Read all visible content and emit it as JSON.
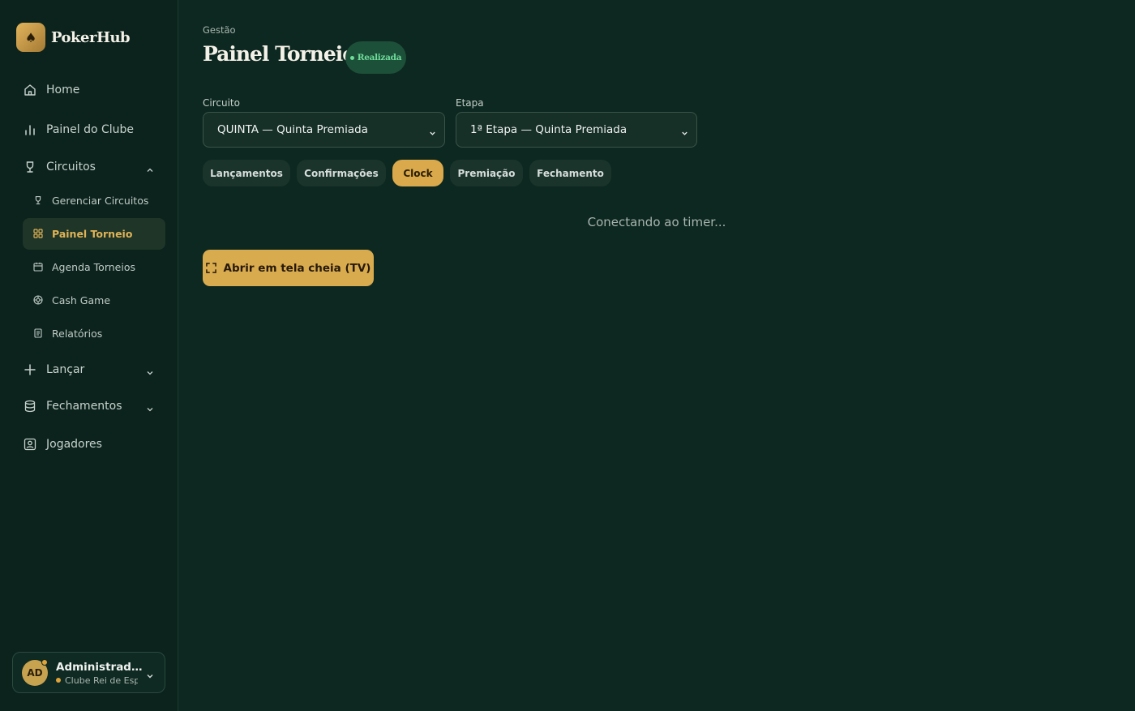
{
  "brand": {
    "name": "PokerHub",
    "logo_glyph": "♠"
  },
  "sidebar": {
    "items": [
      {
        "label": "Home",
        "icon": "home-icon"
      },
      {
        "label": "Painel do Clube",
        "icon": "bar-chart-icon"
      },
      {
        "label": "Circuitos",
        "icon": "trophy-icon",
        "expanded": true
      },
      {
        "label": "Lançar",
        "icon": "plus-icon",
        "expanded": false
      },
      {
        "label": "Fechamentos",
        "icon": "database-icon",
        "expanded": false
      },
      {
        "label": "Jogadores",
        "icon": "user-square-icon"
      }
    ],
    "circuit_subitems": [
      {
        "label": "Gerenciar Circuitos",
        "icon": "trophy-icon"
      },
      {
        "label": "Painel Torneio",
        "icon": "grid-icon",
        "active": true
      },
      {
        "label": "Agenda Torneios",
        "icon": "calendar-icon"
      },
      {
        "label": "Cash Game",
        "icon": "chip-icon"
      },
      {
        "label": "Relatórios",
        "icon": "report-icon"
      }
    ]
  },
  "user": {
    "initials": "AD",
    "name": "Administrador ...",
    "club": "Clube Rei de Espadas"
  },
  "header": {
    "breadcrumb": "Gestão",
    "title": "Painel Torneio",
    "status_badge": "Realizada"
  },
  "filters": {
    "circuit_label": "Circuito",
    "circuit_value": "QUINTA — Quinta Premiada",
    "stage_label": "Etapa",
    "stage_value": "1ª Etapa — Quinta Premiada"
  },
  "tabs": [
    {
      "label": "Lançamentos"
    },
    {
      "label": "Confirmações"
    },
    {
      "label": "Clock",
      "active": true
    },
    {
      "label": "Premiação"
    },
    {
      "label": "Fechamento"
    }
  ],
  "main": {
    "timer_status": "Conectando ao timer...",
    "tv_button_label": "Abrir em tela cheia (TV)"
  },
  "colors": {
    "background": "#0d2820",
    "sidebar": "#0b231c",
    "accent_gold": "#d9ab4f",
    "status_green": "#6fdc9a"
  }
}
